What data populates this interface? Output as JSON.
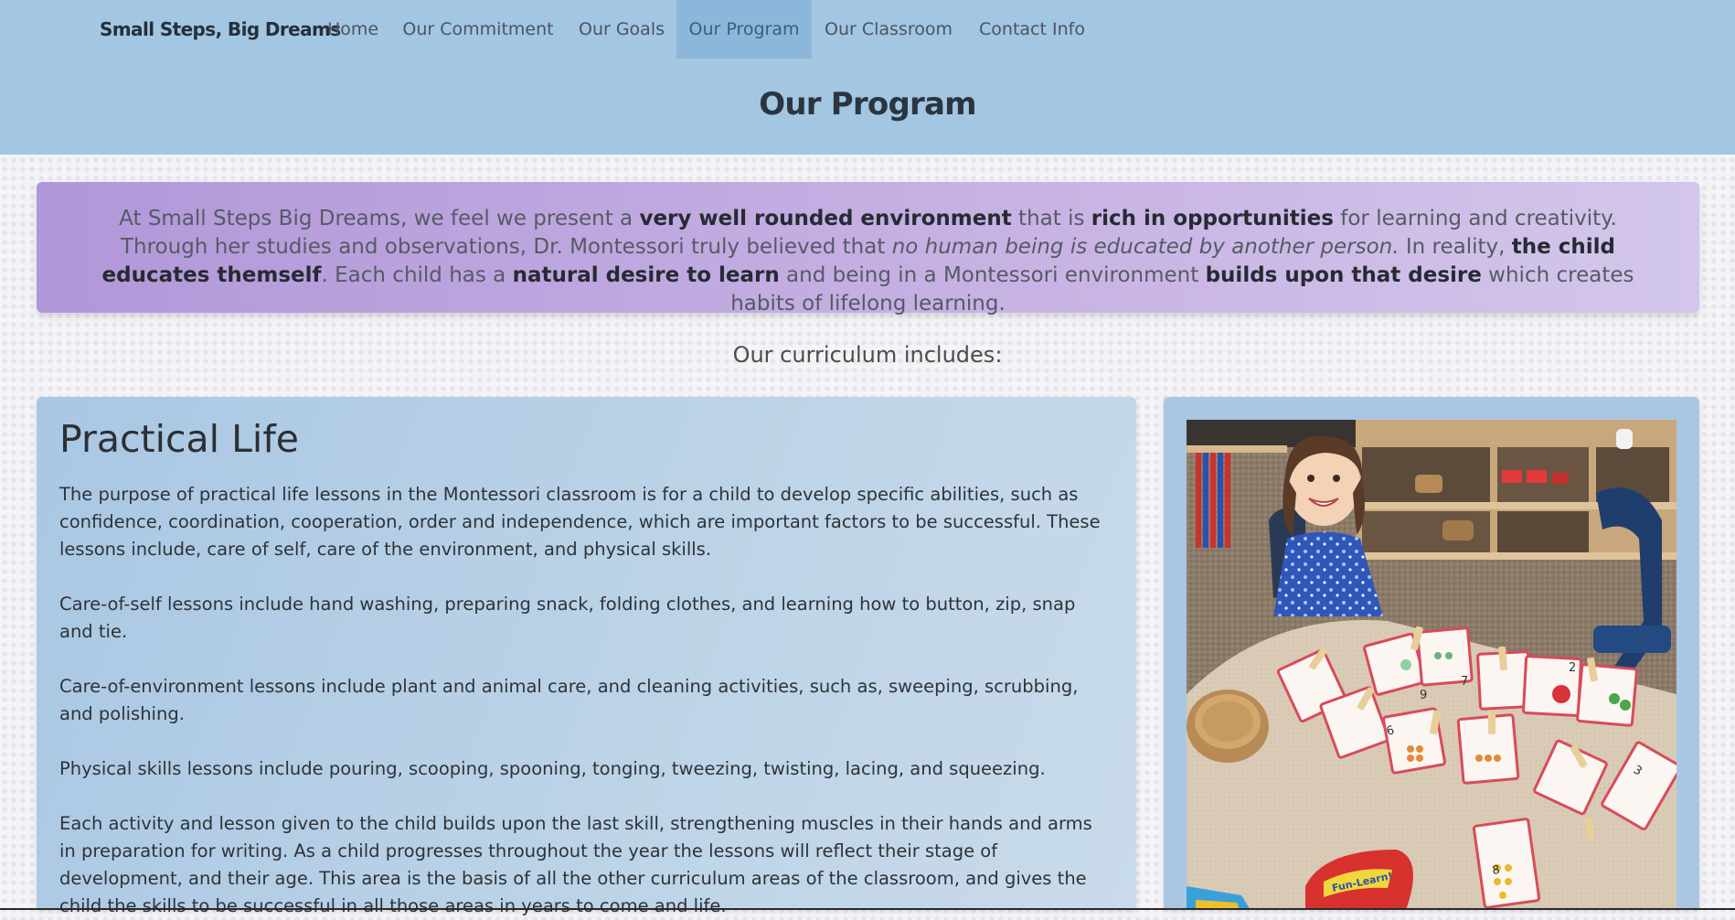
{
  "nav": {
    "brand": "Small Steps, Big Dreams",
    "items": [
      "Home",
      "Our Commitment",
      "Our Goals",
      "Our Program",
      "Our Classroom",
      "Contact Info"
    ],
    "active": "Our Program"
  },
  "page_title": "Our Program",
  "intro": {
    "s1": "At Small Steps Big Dreams, we feel we present a ",
    "b1": "very well rounded environment",
    "s2": " that is ",
    "b2": "rich in opportunities",
    "s3": " for learning and creativity. Through her studies and observations, Dr. Montessori truly believed that ",
    "i1": "no human being is educated by another person.",
    "s4": " In reality, ",
    "b3": "the child educates themself",
    "s5": ". Each child has a ",
    "b4": "natural desire to learn",
    "s6": " and being in a Montessori environment ",
    "b5": "builds upon that desire",
    "s7": " which creates habits of lifelong learning."
  },
  "curriculum_label": "Our curriculum includes:",
  "practical_life": {
    "title": "Practical Life",
    "paragraphs": [
      "The purpose of practical life lessons in the Montessori classroom is for a child to develop specific abilities, such as confidence, coordination, cooperation, order and independence, which are important factors to be successful. These lessons include, care of self, care of the environment, and physical skills.",
      "Care-of-self lessons include hand washing, preparing snack, folding clothes, and learning how to button, zip, snap and tie.",
      "Care-of-environment lessons include plant and animal care, and cleaning activities, such as, sweeping, scrubbing, and polishing.",
      "Physical skills lessons include pouring, scooping, spooning, tonging, tweezing, twisting, lacing, and squeezing.",
      "Each activity and lesson given to the child builds upon the last skill, strengthening muscles in their hands and arms in preparation for writing. As a child progresses throughout the year the lessons will reflect their stage of development, and their age. This area is the basis of all the other curriculum areas of the classroom, and gives the child the skills to be successful in all those areas in years to come and life."
    ]
  },
  "photo": {
    "card_numbers": [
      "6",
      "7",
      "8",
      "9",
      "2",
      "3"
    ],
    "box_text": "Fun-Learn!"
  }
}
